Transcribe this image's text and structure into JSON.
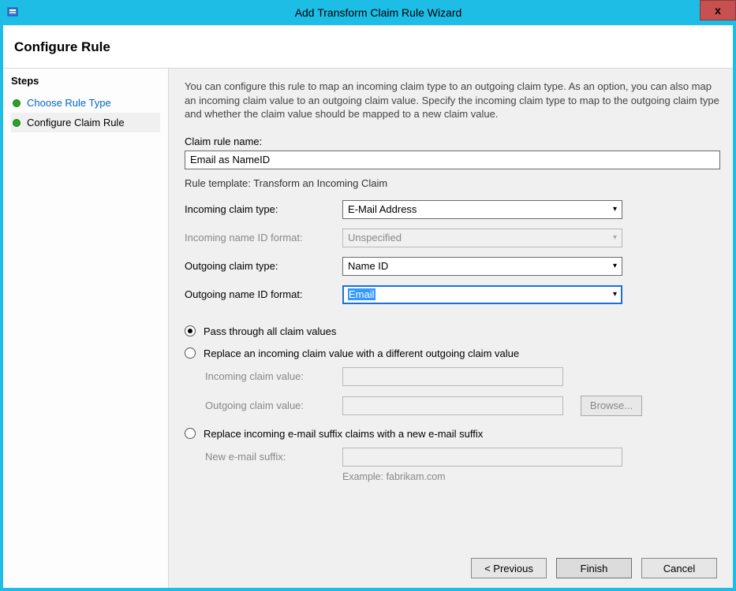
{
  "titlebar": {
    "title": "Add Transform Claim Rule Wizard",
    "close": "x"
  },
  "page_heading": "Configure Rule",
  "sidebar": {
    "heading": "Steps",
    "items": [
      {
        "label": "Choose Rule Type"
      },
      {
        "label": "Configure Claim Rule"
      }
    ]
  },
  "main": {
    "intro": "You can configure this rule to map an incoming claim type to an outgoing claim type. As an option, you can also map an incoming claim value to an outgoing claim value. Specify the incoming claim type to map to the outgoing claim type and whether the claim value should be mapped to a new claim value.",
    "claim_rule_name_label": "Claim rule name:",
    "claim_rule_name_value": "Email as NameID",
    "rule_template_line": "Rule template: Transform an Incoming Claim",
    "incoming_claim_type_label": "Incoming claim type:",
    "incoming_claim_type_value": "E-Mail Address",
    "incoming_name_id_format_label": "Incoming name ID format:",
    "incoming_name_id_format_value": "Unspecified",
    "outgoing_claim_type_label": "Outgoing claim type:",
    "outgoing_claim_type_value": "Name ID",
    "outgoing_name_id_format_label": "Outgoing name ID format:",
    "outgoing_name_id_format_value": "Email",
    "radio_pass_through": "Pass through all claim values",
    "radio_replace_value": "Replace an incoming claim value with a different outgoing claim value",
    "incoming_claim_value_label": "Incoming claim value:",
    "outgoing_claim_value_label": "Outgoing claim value:",
    "browse_label": "Browse...",
    "radio_replace_suffix": "Replace incoming e-mail suffix claims with a new e-mail suffix",
    "new_email_suffix_label": "New e-mail suffix:",
    "example_text": "Example: fabrikam.com"
  },
  "footer": {
    "previous": "< Previous",
    "finish": "Finish",
    "cancel": "Cancel"
  }
}
